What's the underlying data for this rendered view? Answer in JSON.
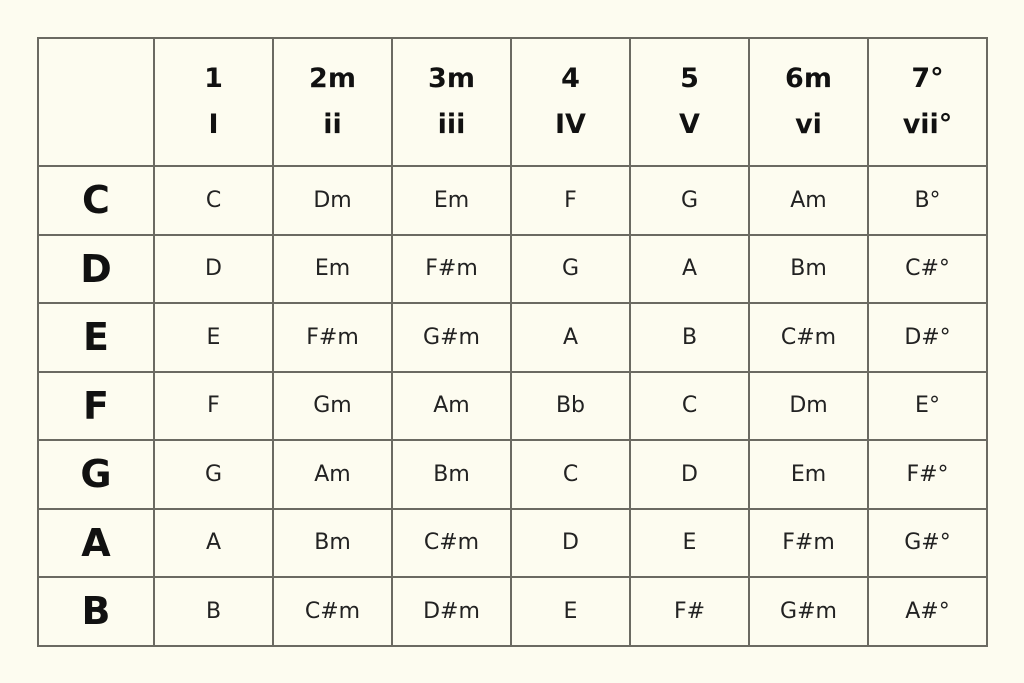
{
  "headers": [
    {
      "number": "1",
      "roman": "I"
    },
    {
      "number": "2m",
      "roman": "ii"
    },
    {
      "number": "3m",
      "roman": "iii"
    },
    {
      "number": "4",
      "roman": "IV"
    },
    {
      "number": "5",
      "roman": "V"
    },
    {
      "number": "6m",
      "roman": "vi"
    },
    {
      "number": "7°",
      "roman": "vii°"
    }
  ],
  "rows": [
    {
      "key": "C",
      "chords": [
        "C",
        "Dm",
        "Em",
        "F",
        "G",
        "Am",
        "B°"
      ]
    },
    {
      "key": "D",
      "chords": [
        "D",
        "Em",
        "F#m",
        "G",
        "A",
        "Bm",
        "C#°"
      ]
    },
    {
      "key": "E",
      "chords": [
        "E",
        "F#m",
        "G#m",
        "A",
        "B",
        "C#m",
        "D#°"
      ]
    },
    {
      "key": "F",
      "chords": [
        "F",
        "Gm",
        "Am",
        "Bb",
        "C",
        "Dm",
        "E°"
      ]
    },
    {
      "key": "G",
      "chords": [
        "G",
        "Am",
        "Bm",
        "C",
        "D",
        "Em",
        "F#°"
      ]
    },
    {
      "key": "A",
      "chords": [
        "A",
        "Bm",
        "C#m",
        "D",
        "E",
        "F#m",
        "G#°"
      ]
    },
    {
      "key": "B",
      "chords": [
        "B",
        "C#m",
        "D#m",
        "E",
        "F#",
        "G#m",
        "A#°"
      ]
    }
  ]
}
